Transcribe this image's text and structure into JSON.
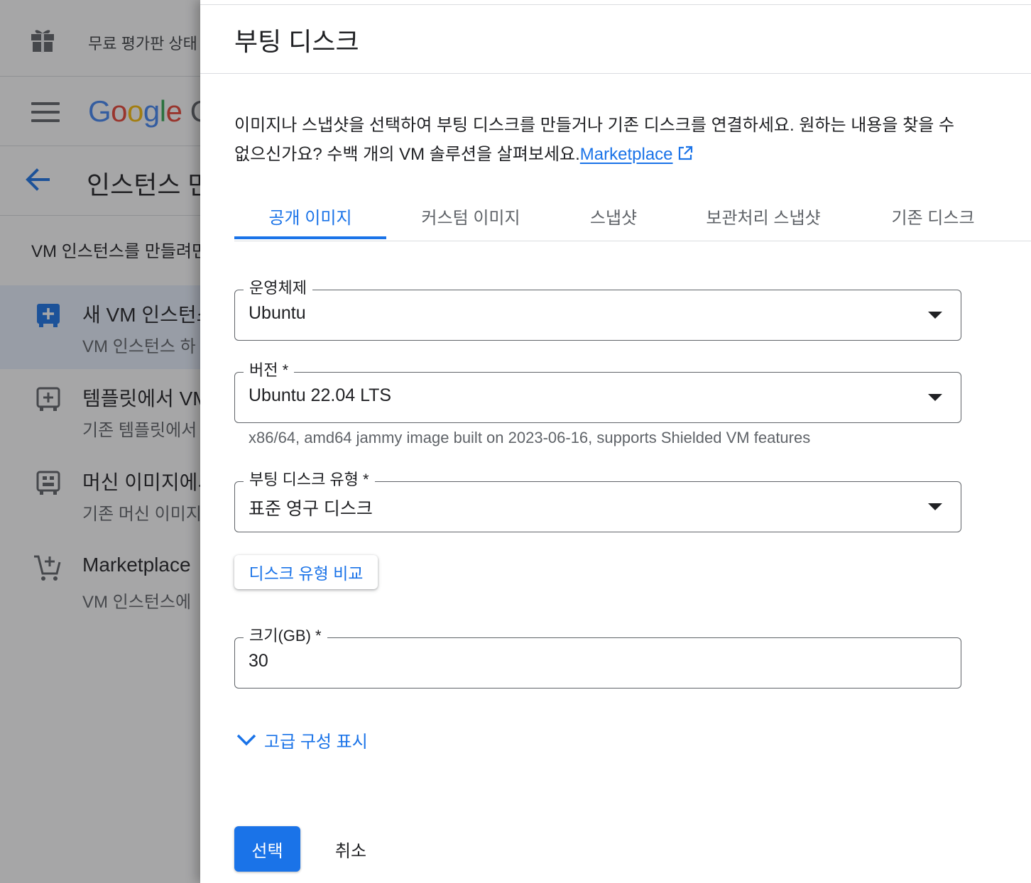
{
  "background": {
    "trial_text": "무료 평가판 상태",
    "logo_letters": [
      "G",
      "o",
      "o",
      "g",
      "l",
      "e",
      " ",
      "C"
    ],
    "page_title": "인스턴스 만",
    "intro": "VM 인스턴스를 만들려면",
    "options": [
      {
        "title": "새 VM 인스턴스",
        "subtitle": "VM 인스턴스 하",
        "icon": "add-box-icon"
      },
      {
        "title": "템플릿에서 VM",
        "subtitle": "기존 템플릿에서",
        "icon": "template-add-icon"
      },
      {
        "title": "머신 이미지에서",
        "subtitle": "기존 머신 이미지",
        "icon": "machine-image-icon"
      },
      {
        "title": "Marketplace",
        "subtitle": "VM 인스턴스에",
        "icon": "cart-icon"
      }
    ]
  },
  "panel": {
    "title": "부팅 디스크",
    "description": "이미지나 스냅샷을 선택하여 부팅 디스크를 만들거나 기존 디스크를 연결하세요. 원하는 내용을 찾을 수 없으신가요? 수백 개의 VM 솔루션을 살펴보세요.",
    "marketplace_link": "Marketplace",
    "tabs": [
      "공개 이미지",
      "커스텀 이미지",
      "스냅샷",
      "보관처리 스냅샷",
      "기존 디스크"
    ],
    "active_tab": "공개 이미지",
    "os": {
      "label": "운영체제",
      "value": "Ubuntu"
    },
    "version": {
      "label": "버전 *",
      "value": "Ubuntu 22.04 LTS",
      "hint": "x86/64, amd64 jammy image built on 2023-06-16, supports Shielded VM features"
    },
    "disk_type": {
      "label": "부팅 디스크 유형 *",
      "value": "표준 영구 디스크"
    },
    "compare_button": "디스크 유형 비교",
    "size": {
      "label": "크기(GB) *",
      "value": "30"
    },
    "advanced_toggle": "고급 구성 표시",
    "select_button": "선택",
    "cancel_button": "취소"
  },
  "colors": {
    "accent": "#1a73e8",
    "text": "#202124",
    "secondary": "#5f6368",
    "scrim": "rgba(32,33,36,0.40)"
  }
}
